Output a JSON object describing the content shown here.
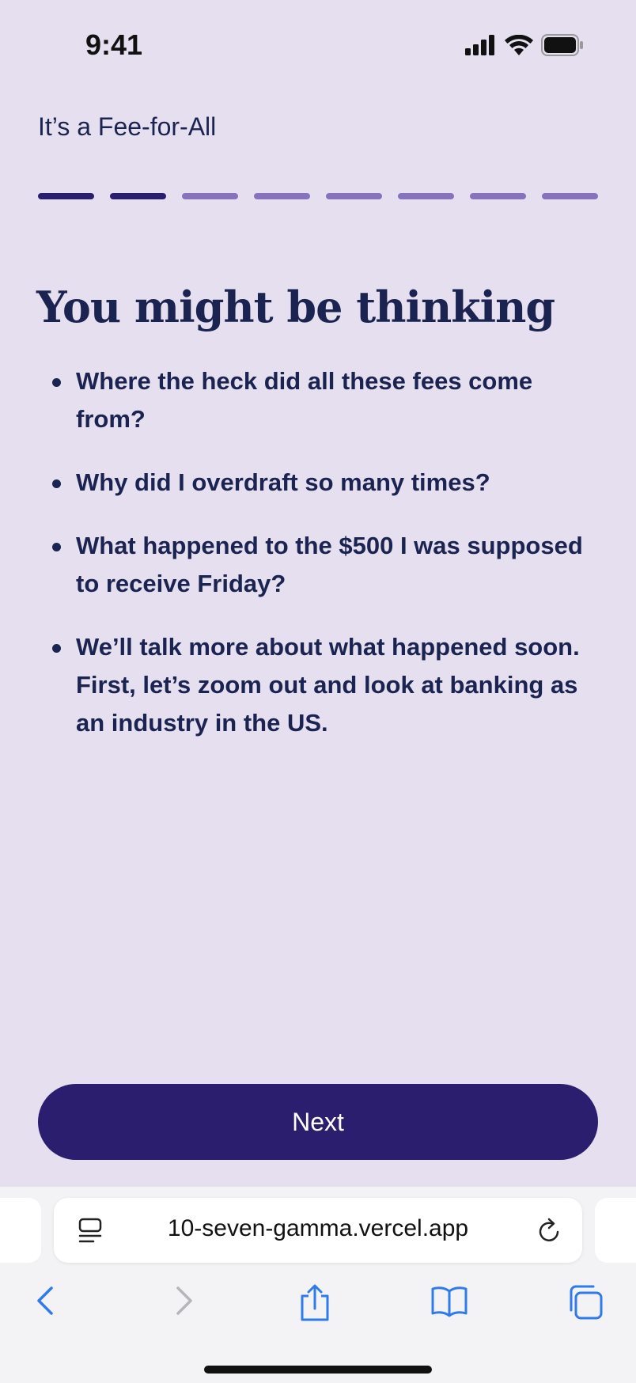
{
  "status_bar": {
    "time": "9:41",
    "icons": [
      "cellular-signal-icon",
      "wifi-icon",
      "battery-icon"
    ]
  },
  "header": {
    "title": "It’s a Fee-for-All"
  },
  "progress": {
    "total_steps": 8,
    "completed_steps": 2,
    "colors": {
      "done": "#2B1E6E",
      "pending": "#8673BC"
    }
  },
  "content": {
    "heading": "You might be thinking",
    "bullets": [
      "Where the heck did all these fees come from?",
      "Why did I overdraft so many times?",
      "What happened to the $500 I was supposed to receive Friday?",
      "We’ll talk more about what happened soon. First, let’s zoom out and look at banking as an industry in the US."
    ]
  },
  "actions": {
    "next_label": "Next"
  },
  "browser": {
    "url": "10-seven-gamma.vercel.app",
    "toolbar_icons": [
      "back-icon",
      "forward-icon",
      "share-icon",
      "bookmarks-icon",
      "tabs-icon"
    ]
  },
  "colors": {
    "background": "#E6DFEF",
    "text": "#1B2451",
    "accent": "#2B1E6E",
    "browser_accent": "#2F7BEA"
  }
}
